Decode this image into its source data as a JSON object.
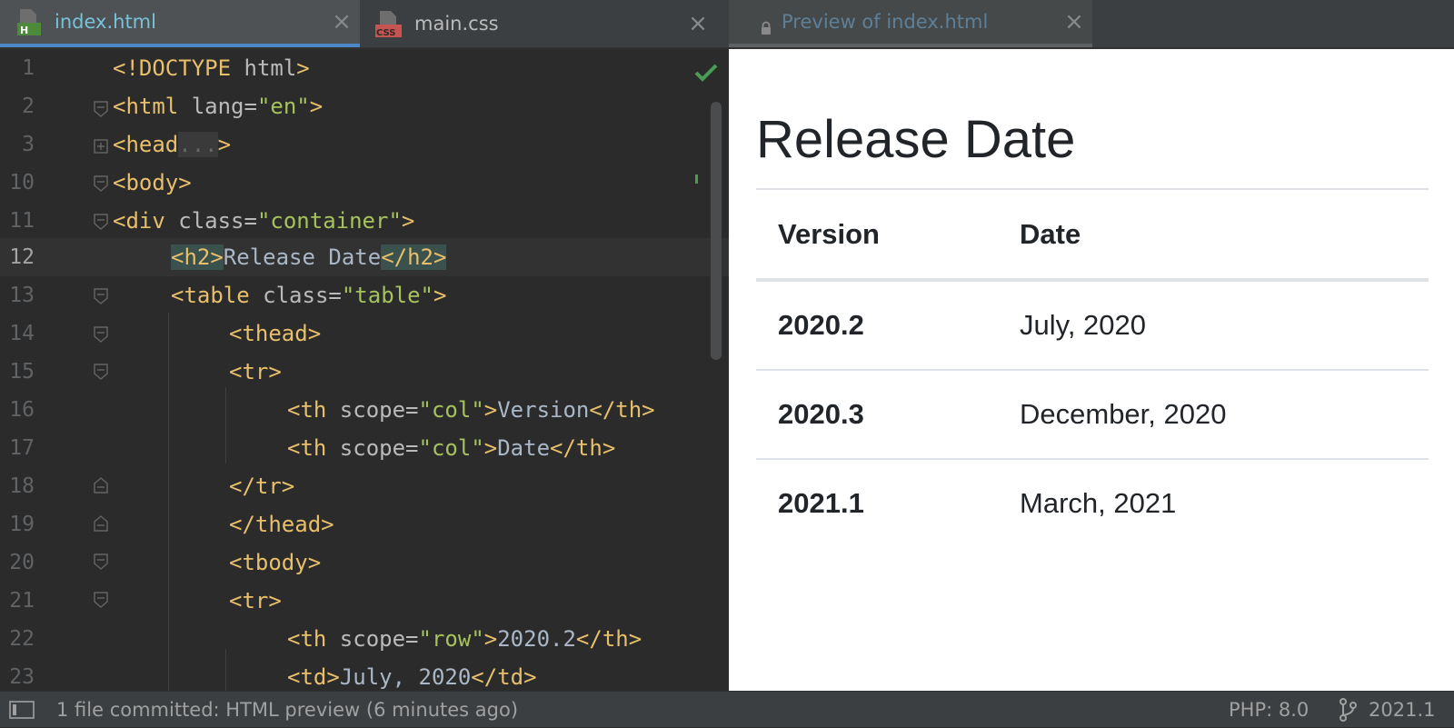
{
  "tabs": [
    {
      "label": "index.html",
      "icon": "html-file-icon",
      "icon_text": "H",
      "active": true
    },
    {
      "label": "main.css",
      "icon": "css-file-icon",
      "icon_text": "CSS",
      "active": false
    },
    {
      "label": "Preview of index.html",
      "icon": "lock-icon",
      "active": false
    }
  ],
  "editor": {
    "line_numbers": [
      "1",
      "2",
      "3",
      "10",
      "11",
      "12",
      "13",
      "14",
      "15",
      "16",
      "17",
      "18",
      "19",
      "20",
      "21",
      "22",
      "23"
    ],
    "current_line": "12",
    "lines": [
      {
        "t1": "<!DOCTYPE",
        "a1": " html",
        "t2": ">"
      },
      {
        "t1": "<html",
        "a1": " lang=",
        "s1": "\"en\"",
        "t2": ">"
      },
      {
        "t1": "<head",
        "f1": "...",
        "t2": ">"
      },
      {
        "t1": "<body>"
      },
      {
        "t1": "<div",
        "a1": " class=",
        "s1": "\"container\"",
        "t2": ">"
      },
      {
        "t1": "<h2>",
        "x1": "Release Date",
        "t2": "</h2>"
      },
      {
        "t1": "<table",
        "a1": " class=",
        "s1": "\"table\"",
        "t2": ">"
      },
      {
        "t1": "<thead>"
      },
      {
        "t1": "<tr>"
      },
      {
        "t1": "<th",
        "a1": " scope=",
        "s1": "\"col\"",
        "t2": ">",
        "x1": "Version",
        "t3": "</th>"
      },
      {
        "t1": "<th",
        "a1": " scope=",
        "s1": "\"col\"",
        "t2": ">",
        "x1": "Date",
        "t3": "</th>"
      },
      {
        "t1": "</tr>"
      },
      {
        "t1": "</thead>"
      },
      {
        "t1": "<tbody>"
      },
      {
        "t1": "<tr>"
      },
      {
        "t1": "<th",
        "a1": " scope=",
        "s1": "\"row\"",
        "t2": ">",
        "x1": "2020.2",
        "t3": "</th>"
      },
      {
        "t1": "<td>",
        "x1": "July, 2020",
        "t2": "</td>"
      }
    ]
  },
  "preview": {
    "heading": "Release Date",
    "columns": [
      "Version",
      "Date"
    ],
    "rows": [
      {
        "version": "2020.2",
        "date": "July, 2020"
      },
      {
        "version": "2020.3",
        "date": "December, 2020"
      },
      {
        "version": "2021.1",
        "date": "March, 2021"
      }
    ]
  },
  "status": {
    "message": "1 file committed: HTML preview (6 minutes ago)",
    "php": "PHP: 8.0",
    "branch": "2021.1"
  },
  "colors": {
    "tag": "#e8bf6a",
    "attribute": "#bababa",
    "string": "#a5c25c",
    "text": "#a9b7c6",
    "active_tab_underline": "#4a88c7",
    "check": "#499c54"
  }
}
